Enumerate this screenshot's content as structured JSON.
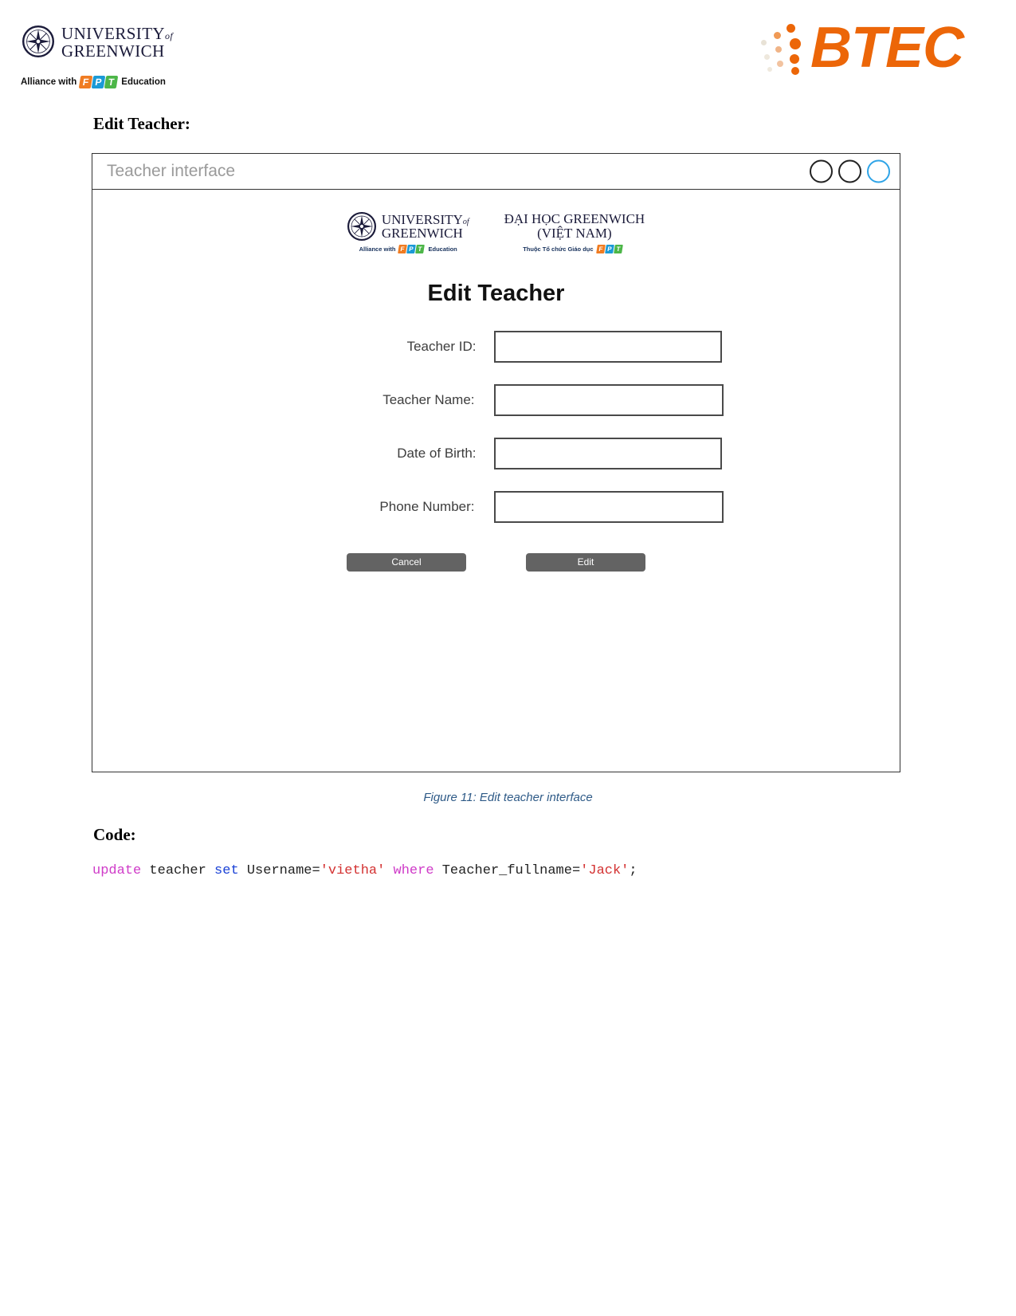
{
  "page_header": {
    "university_logo": {
      "icon": "compass-rose-icon",
      "line1": "UNIVERSITY",
      "line1_small": "of",
      "line2": "GREENWICH",
      "alliance_prefix": "Alliance with",
      "fpt_letters": [
        "F",
        "P",
        "T"
      ],
      "alliance_suffix": "Education"
    },
    "btec_logo": {
      "icon": "btec-dots-icon",
      "wordmark": "BTEC",
      "color": "#ec6608"
    }
  },
  "sections": {
    "edit_teacher_heading": "Edit Teacher:",
    "code_heading": "Code:"
  },
  "window": {
    "title": "Teacher interface",
    "controls": [
      {
        "name": "minimize-button",
        "accent": false
      },
      {
        "name": "maximize-button",
        "accent": false
      },
      {
        "name": "close-button",
        "accent": true
      }
    ],
    "inner_logos": {
      "left": {
        "icon": "compass-rose-icon",
        "line1": "UNIVERSITY",
        "line1_small": "of",
        "line2": "GREENWICH",
        "sub_prefix": "Alliance with",
        "fpt_letters": [
          "F",
          "P",
          "T"
        ],
        "sub_suffix": "Education"
      },
      "right": {
        "line1": "ĐẠI HỌC GREENWICH",
        "line2": "(VIỆT NAM)",
        "sub_prefix": "Thuộc Tổ chức Giáo dục",
        "fpt_letters": [
          "F",
          "P",
          "T"
        ]
      }
    },
    "form": {
      "title": "Edit Teacher",
      "fields": [
        {
          "label": "Teacher ID:",
          "value": "",
          "placeholder": ""
        },
        {
          "label": "Teacher Name:",
          "value": "",
          "placeholder": ""
        },
        {
          "label": "Date of Birth:",
          "value": "",
          "placeholder": ""
        },
        {
          "label": "Phone Number:",
          "value": "",
          "placeholder": ""
        }
      ],
      "buttons": {
        "cancel": "Cancel",
        "submit": "Edit"
      }
    }
  },
  "caption": "Figure 11: Edit teacher interface",
  "code": {
    "tokens": [
      {
        "text": "update",
        "cls": "k-kw"
      },
      {
        "text": " teacher ",
        "cls": "k-plain"
      },
      {
        "text": "set",
        "cls": "k-kw2"
      },
      {
        "text": " Username=",
        "cls": "k-plain"
      },
      {
        "text": "'vietha'",
        "cls": "k-str"
      },
      {
        "text": " ",
        "cls": "k-plain"
      },
      {
        "text": "where",
        "cls": "k-kw"
      },
      {
        "text": " Teacher_fullname=",
        "cls": "k-plain"
      },
      {
        "text": "'Jack'",
        "cls": "k-str"
      },
      {
        "text": ";",
        "cls": "k-plain"
      }
    ],
    "plain": "update teacher set Username='vietha' where Teacher_fullname='Jack';"
  }
}
